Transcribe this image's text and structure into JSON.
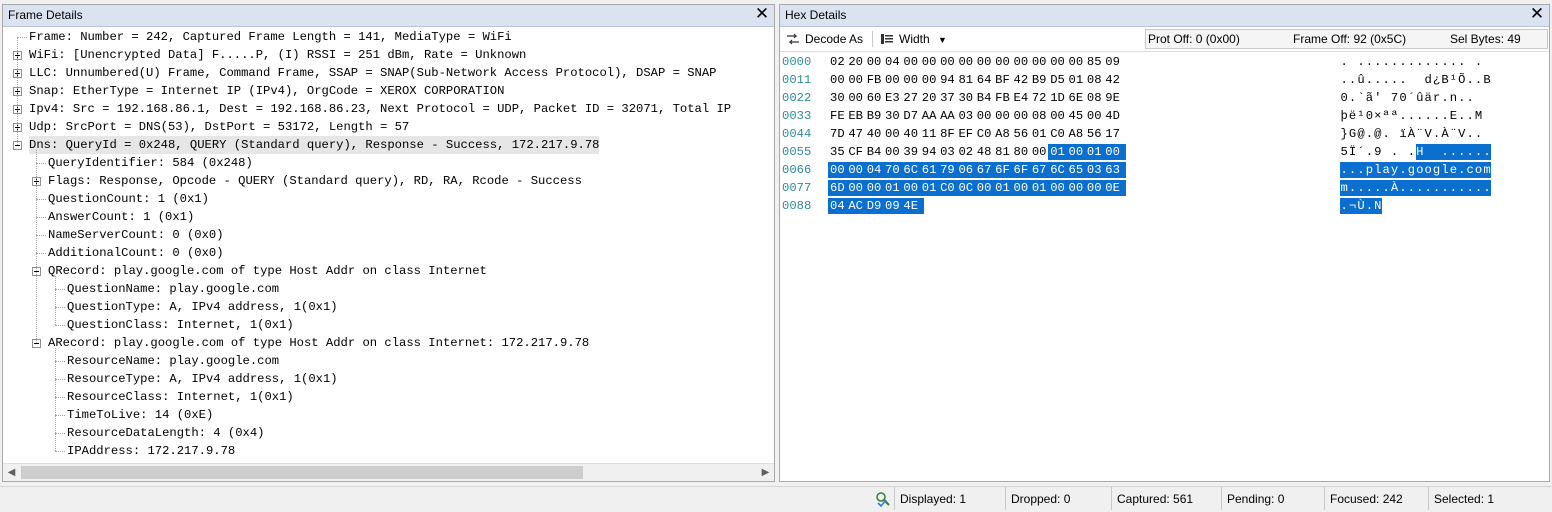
{
  "frame_panel": {
    "title": "Frame Details",
    "close_glyph": "✕",
    "tree": [
      {
        "level": 0,
        "expander": "none",
        "text": "Frame: Number = 242, Captured Frame Length = 141, MediaType = WiFi"
      },
      {
        "level": 0,
        "expander": "plus",
        "text": "WiFi: [Unencrypted Data] F.....P, (I) RSSI = 251 dBm, Rate = Unknown"
      },
      {
        "level": 0,
        "expander": "plus",
        "text": "LLC: Unnumbered(U) Frame, Command Frame, SSAP = SNAP(Sub-Network Access Protocol), DSAP = SNAP"
      },
      {
        "level": 0,
        "expander": "plus",
        "text": "Snap: EtherType = Internet IP (IPv4), OrgCode = XEROX CORPORATION"
      },
      {
        "level": 0,
        "expander": "plus",
        "text": "Ipv4: Src = 192.168.86.1, Dest = 192.168.86.23, Next Protocol = UDP, Packet ID = 32071, Total IP"
      },
      {
        "level": 0,
        "expander": "plus",
        "text": "Udp: SrcPort = DNS(53), DstPort = 53172, Length = 57"
      },
      {
        "level": 0,
        "expander": "minus",
        "text": "Dns: QueryId = 0x248, QUERY (Standard query), Response - Success, 172.217.9.78",
        "selected": true
      },
      {
        "level": 1,
        "expander": "none",
        "text": "QueryIdentifier: 584 (0x248)"
      },
      {
        "level": 1,
        "expander": "plus",
        "text": "Flags:  Response, Opcode - QUERY (Standard query), RD, RA, Rcode - Success"
      },
      {
        "level": 1,
        "expander": "none",
        "text": "QuestionCount: 1 (0x1)"
      },
      {
        "level": 1,
        "expander": "none",
        "text": "AnswerCount: 1 (0x1)"
      },
      {
        "level": 1,
        "expander": "none",
        "text": "NameServerCount: 0 (0x0)"
      },
      {
        "level": 1,
        "expander": "none",
        "text": "AdditionalCount: 0 (0x0)"
      },
      {
        "level": 1,
        "expander": "minus",
        "text": "QRecord: play.google.com of type Host Addr on class Internet"
      },
      {
        "level": 2,
        "expander": "none",
        "text": "QuestionName: play.google.com"
      },
      {
        "level": 2,
        "expander": "none",
        "text": "QuestionType: A, IPv4 address, 1(0x1)"
      },
      {
        "level": 2,
        "expander": "none",
        "text": "QuestionClass: Internet, 1(0x1)"
      },
      {
        "level": 1,
        "expander": "minus",
        "text": "ARecord: play.google.com of type Host Addr on class Internet: 172.217.9.78"
      },
      {
        "level": 2,
        "expander": "none",
        "text": "ResourceName: play.google.com"
      },
      {
        "level": 2,
        "expander": "none",
        "text": "ResourceType: A, IPv4 address, 1(0x1)"
      },
      {
        "level": 2,
        "expander": "none",
        "text": "ResourceClass: Internet, 1(0x1)"
      },
      {
        "level": 2,
        "expander": "none",
        "text": "TimeToLive: 14 (0xE)"
      },
      {
        "level": 2,
        "expander": "none",
        "text": "ResourceDataLength: 4 (0x4)"
      },
      {
        "level": 2,
        "expander": "none",
        "text": "IPAddress: 172.217.9.78"
      }
    ]
  },
  "hex_panel": {
    "title": "Hex Details",
    "close_glyph": "✕",
    "toolbar": {
      "decode_as_label": "Decode As",
      "width_label": "Width",
      "prot_off": "Prot Off: 0 (0x00)",
      "frame_off": "Frame Off: 92 (0x5C)",
      "sel_bytes": "Sel Bytes: 49"
    },
    "selection": {
      "start": 92,
      "length": 49
    },
    "rows": [
      {
        "offset": "0000",
        "bytes": [
          "02",
          "20",
          "00",
          "04",
          "00",
          "00",
          "00",
          "00",
          "00",
          "00",
          "00",
          "00",
          "00",
          "00",
          "85",
          "09"
        ],
        "ascii": ". ............. ."
      },
      {
        "offset": "0011",
        "bytes": [
          "00",
          "00",
          "FB",
          "00",
          "00",
          "00",
          "94",
          "81",
          "64",
          "BF",
          "42",
          "B9",
          "D5",
          "01",
          "08",
          "42"
        ],
        "ascii": "..û.....  d¿B¹Õ..B"
      },
      {
        "offset": "0022",
        "bytes": [
          "30",
          "00",
          "60",
          "E3",
          "27",
          "20",
          "37",
          "30",
          "B4",
          "FB",
          "E4",
          "72",
          "1D",
          "6E",
          "08",
          "9E"
        ],
        "ascii": "0.`ã' 70´ûär.n.."
      },
      {
        "offset": "0033",
        "bytes": [
          "FE",
          "EB",
          "B9",
          "30",
          "D7",
          "AA",
          "AA",
          "03",
          "00",
          "00",
          "00",
          "08",
          "00",
          "45",
          "00",
          "4D"
        ],
        "ascii": "þë¹0×ªª......E..M"
      },
      {
        "offset": "0044",
        "bytes": [
          "7D",
          "47",
          "40",
          "00",
          "40",
          "11",
          "8F",
          "EF",
          "C0",
          "A8",
          "56",
          "01",
          "C0",
          "A8",
          "56",
          "17"
        ],
        "ascii": "}G@.@. ïÀ¨V.À¨V.."
      },
      {
        "offset": "0055",
        "bytes": [
          "35",
          "CF",
          "B4",
          "00",
          "39",
          "94",
          "03",
          "02",
          "48",
          "81",
          "80",
          "00",
          "01",
          "00",
          "01",
          "00"
        ],
        "ascii": "5Ï´.9 . .H  ......"
      },
      {
        "offset": "0066",
        "bytes": [
          "00",
          "00",
          "04",
          "70",
          "6C",
          "61",
          "79",
          "06",
          "67",
          "6F",
          "6F",
          "67",
          "6C",
          "65",
          "03",
          "63"
        ],
        "ascii": "...play.google.com"
      },
      {
        "offset": "0077",
        "bytes": [
          "6D",
          "00",
          "00",
          "01",
          "00",
          "01",
          "C0",
          "0C",
          "00",
          "01",
          "00",
          "01",
          "00",
          "00",
          "00",
          "0E"
        ],
        "ascii": "m.....À..........."
      },
      {
        "offset": "0088",
        "bytes": [
          "04",
          "AC",
          "D9",
          "09",
          "4E"
        ],
        "ascii": ".¬Ù.N"
      }
    ]
  },
  "status_bar": {
    "displayed": "Displayed: 1",
    "dropped": "Dropped: 0",
    "captured": "Captured: 561",
    "pending": "Pending: 0",
    "focused": "Focused: 242",
    "selected": "Selected: 1"
  }
}
